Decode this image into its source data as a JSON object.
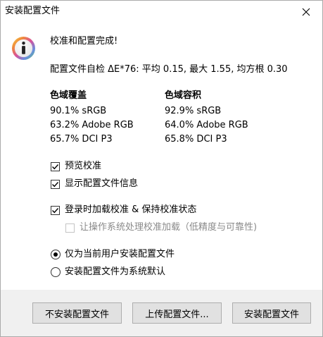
{
  "window": {
    "title": "安装配置文件",
    "close_icon": "close-icon"
  },
  "main": {
    "info_icon": "info-icon",
    "headline": "校准和配置完成!",
    "self_check": "配置文件自检 ΔE*76: 平均 0.15, 最大 1.55, 均方根 0.30",
    "gamut_coverage": {
      "heading": "色域覆盖",
      "values": [
        "90.1% sRGB",
        "63.2% Adobe RGB",
        "65.7% DCI P3"
      ]
    },
    "gamut_volume": {
      "heading": "色域容积",
      "values": [
        "92.9% sRGB",
        "64.0% Adobe RGB",
        "65.8% DCI P3"
      ]
    },
    "options": {
      "preview_calibration": {
        "label": "预览校准",
        "checked": true
      },
      "show_profile_info": {
        "label": "显示配置文件信息",
        "checked": true
      },
      "load_on_login": {
        "label": "登录时加载校准 & 保持校准状态",
        "checked": true
      },
      "os_handles_loading": {
        "label": "让操作系统处理校准加载（低精度与可靠性)",
        "checked": false,
        "disabled": true
      }
    },
    "install_scope": {
      "current_user": {
        "label": "仅为当前用户安装配置文件",
        "selected": true
      },
      "system_default": {
        "label": "安装配置文件为系统默认",
        "selected": false
      }
    }
  },
  "footer": {
    "dont_install": "不安装配置文件",
    "upload": "上传配置文件...",
    "install": "安装配置文件"
  }
}
